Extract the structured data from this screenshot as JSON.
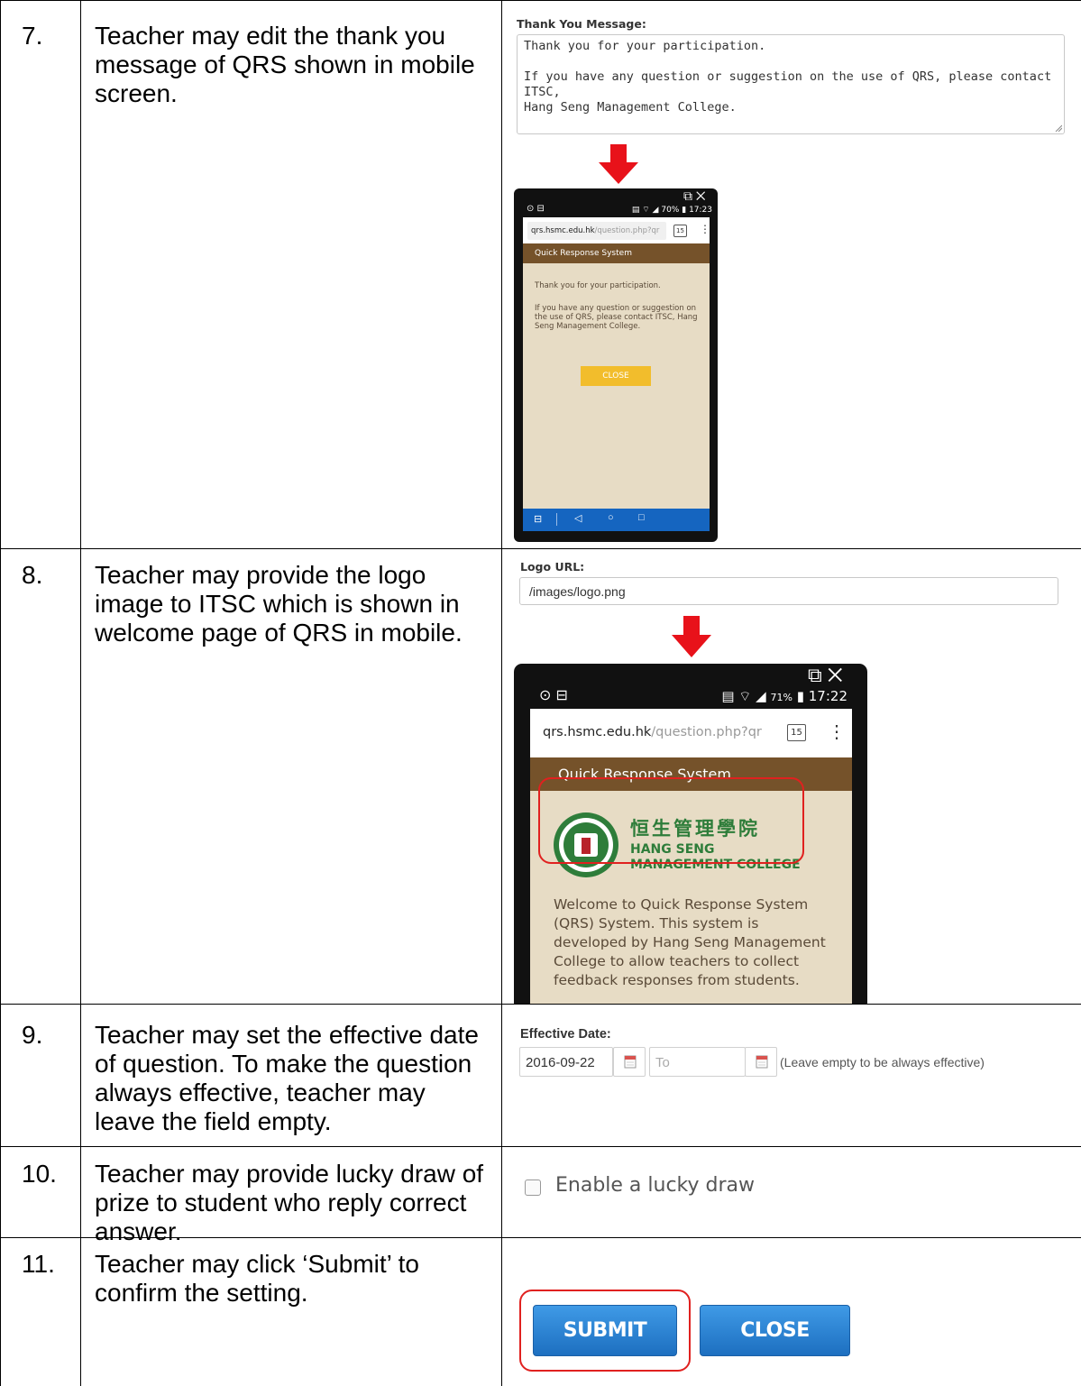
{
  "rows": [
    {
      "num": "7.",
      "text": "Teacher may edit the thank you message of QRS shown in mobile screen."
    },
    {
      "num": "8.",
      "text": "Teacher may provide the logo image to ITSC which is shown in welcome page of QRS in mobile."
    },
    {
      "num": "9.",
      "text": "Teacher may set the effective date of question. To make the question always effective, teacher may leave the field empty."
    },
    {
      "num": "10.",
      "text": "Teacher may provide lucky draw of prize to student who reply correct answer."
    },
    {
      "num": "11.",
      "text": "Teacher may click ‘Submit’ to confirm the setting."
    }
  ],
  "thanks": {
    "label": "Thank You Message:",
    "line1": "Thank you for your participation.",
    "line2": "If you have any question or suggestion on the use of QRS, please contact ITSC,",
    "line3": "Hang Seng Management College."
  },
  "phone1": {
    "time": "17:23",
    "battery": "70%",
    "url_host": "qrs.hsmc.edu.hk",
    "url_path": "/question.php?qr",
    "tab_count": "15",
    "app_title": "Quick Response System",
    "msg1": "Thank you for your participation.",
    "msg2": "If you have any question or suggestion on the use of QRS, please contact ITSC, Hang Seng Management College.",
    "close": "CLOSE"
  },
  "logo": {
    "label": "Logo URL:",
    "value": "/images/logo.png"
  },
  "phone2": {
    "time": "17:22",
    "battery": "71%",
    "url_host": "qrs.hsmc.edu.hk",
    "url_path": "/question.php?qr",
    "tab_count": "15",
    "app_title": "Quick Response System",
    "logo_chinese": "恒生管理學院",
    "logo_en1": "HANG SENG",
    "logo_en2": "MANAGEMENT COLLEGE",
    "welcome": "Welcome to Quick Response System (QRS) System. This system is developed by Hang Seng Management College to allow teachers to collect feedback responses from students."
  },
  "effective": {
    "label": "Effective Date:",
    "from_value": "2016-09-22",
    "to_placeholder": "To",
    "hint": "(Leave empty to be always effective)"
  },
  "lucky": {
    "label": "Enable a lucky draw"
  },
  "buttons": {
    "submit": "SUBMIT",
    "close": "CLOSE"
  },
  "colors": {
    "submit_blue": "#1d6fc0",
    "highlight_red": "#e0211f",
    "app_brown": "#75522a",
    "close_yellow": "#f2bd2c"
  }
}
